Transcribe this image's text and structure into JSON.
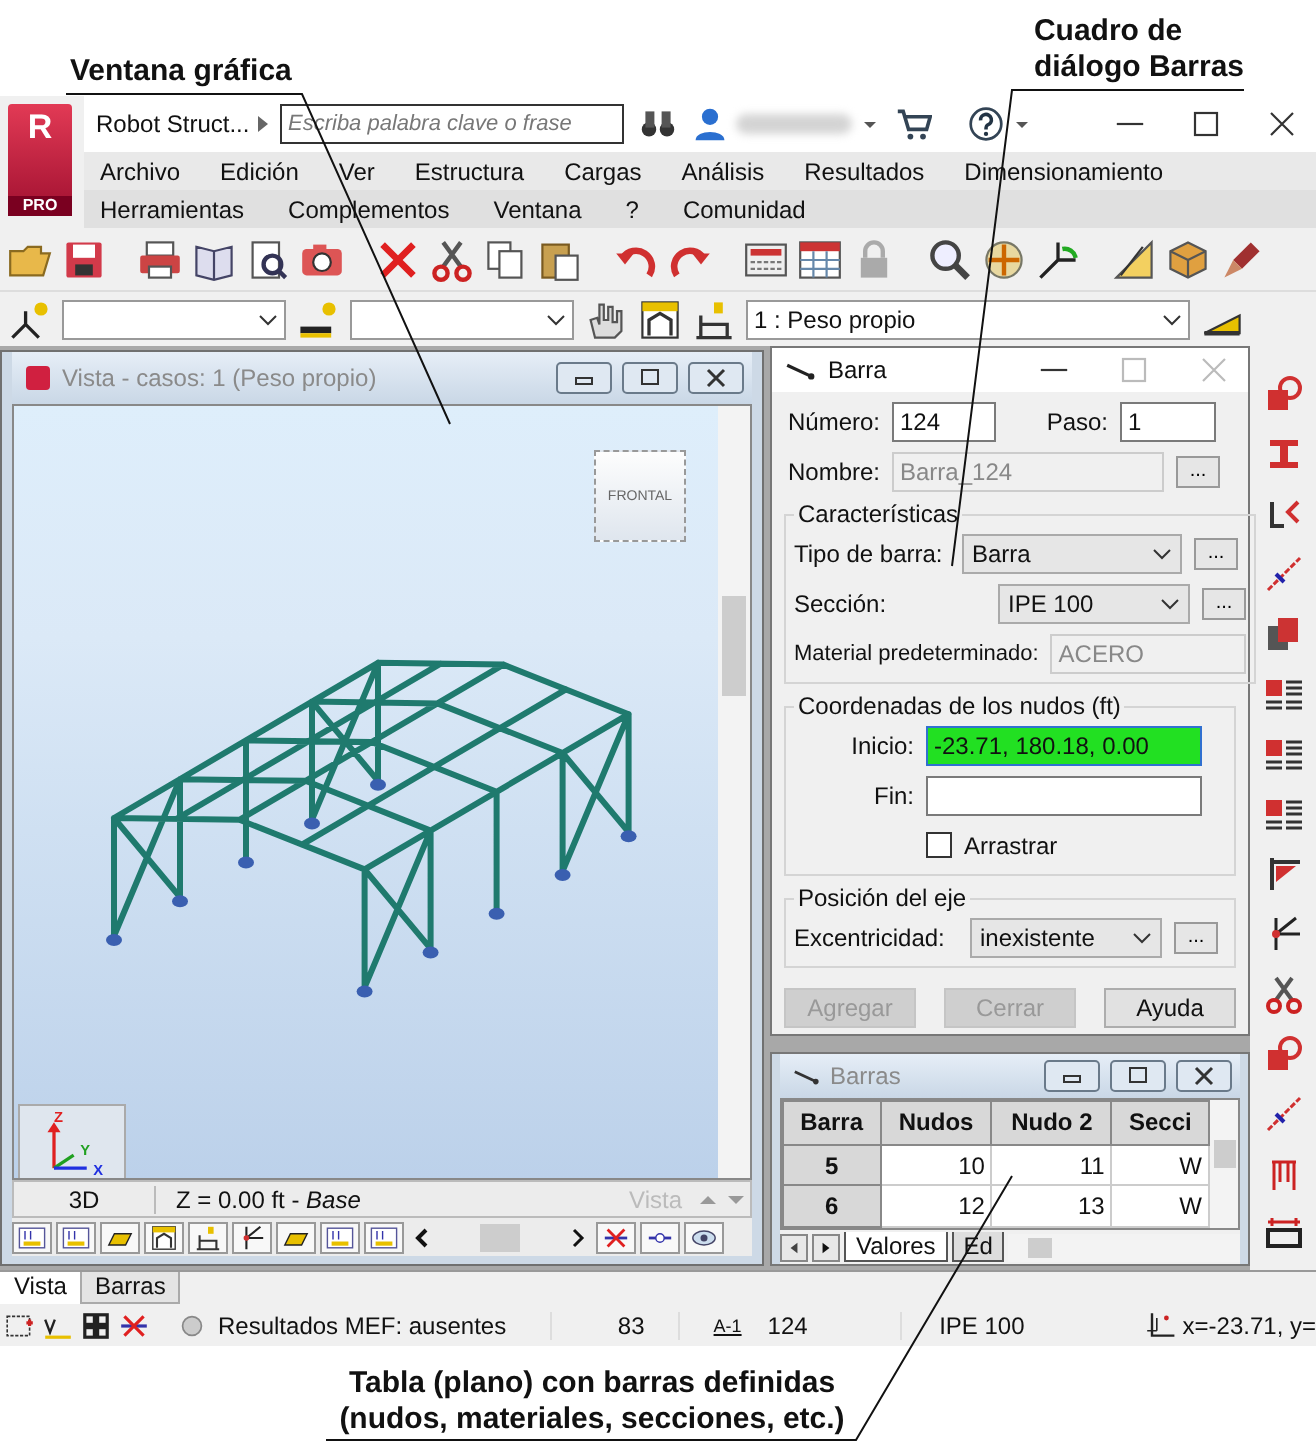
{
  "callouts": {
    "viewport": "Ventana gráfica",
    "dialog": [
      "Cuadro de",
      "diálogo Barras"
    ],
    "table": [
      "Tabla (plano) con barras definidas",
      "(nudos, materiales, secciones, etc.)"
    ]
  },
  "app": {
    "logo": {
      "letter": "R",
      "badge": "PRO"
    },
    "title": "Robot Struct...",
    "search": {
      "placeholder": "Escriba palabra clave o frase"
    }
  },
  "menu_rows": [
    [
      "Archivo",
      "Edición",
      "Ver",
      "Estructura",
      "Cargas",
      "Análisis",
      "Resultados",
      "Dimensionamiento"
    ],
    [
      "Herramientas",
      "Complementos",
      "Ventana",
      "?",
      "Comunidad"
    ]
  ],
  "toolbar": {
    "load_case": "1 : Peso propio"
  },
  "view_window": {
    "title": "Vista - casos: 1 (Peso propio)",
    "active": false,
    "cube_face": "FRONTAL",
    "axes": [
      "Z",
      "Y",
      "X"
    ],
    "mode": "3D",
    "plane": "Z = 0.00 ft - *Base*",
    "view_label": "Vista"
  },
  "dialog": {
    "title": "Barra",
    "number": {
      "label": "Número:",
      "value": "124"
    },
    "step": {
      "label": "Paso:",
      "value": "1"
    },
    "name": {
      "label": "Nombre:",
      "value": "Barra_124",
      "disabled": true,
      "more": "..."
    },
    "characteristics": {
      "title": "Características",
      "bar_type": {
        "label": "Tipo de barra:",
        "value": "Barra",
        "more": "..."
      },
      "section": {
        "label": "Sección:",
        "value": "IPE 100",
        "more": "..."
      },
      "material": {
        "label": "Material predeterminado:",
        "value": "ACERO",
        "disabled": true
      }
    },
    "coordinates": {
      "title": "Coordenadas de los nudos (ft)",
      "start": {
        "label": "Inicio:",
        "value": "-23.71, 180.18, 0.00",
        "highlighted": true
      },
      "end": {
        "label": "Fin:",
        "highlighted": false
      },
      "drag": {
        "label": "Arrastrar",
        "checked": false
      }
    },
    "axis": {
      "title": "Posición del eje",
      "eccentricity": {
        "label": "Excentricidad:",
        "value": "inexistente",
        "more": "..."
      }
    },
    "buttons": [
      {
        "label": "Agregar",
        "disabled": true
      },
      {
        "label": "Cerrar",
        "disabled": true
      },
      {
        "label": "Ayuda",
        "disabled": false
      }
    ]
  },
  "table_window": {
    "title": "Barras",
    "columns": [
      "Barra",
      "Nudos",
      "Nudo 2",
      "Secci"
    ],
    "rows": [
      [
        "5",
        "10",
        "11",
        "W"
      ],
      [
        "6",
        "12",
        "13",
        "W"
      ]
    ],
    "tabs": [
      {
        "label": "Valores",
        "selected": true
      },
      {
        "label": "Ed",
        "selected": false
      }
    ]
  },
  "bottom_tabs": [
    {
      "label": "Vista",
      "selected": true
    },
    {
      "label": "Barras",
      "selected": false
    }
  ],
  "status_bar": {
    "results": "Resultados MEF: ausentes",
    "nodes": "83",
    "bar_tag": "A-1",
    "bar": "124",
    "section": "IPE 100",
    "coords": "x=-23.71, y="
  }
}
